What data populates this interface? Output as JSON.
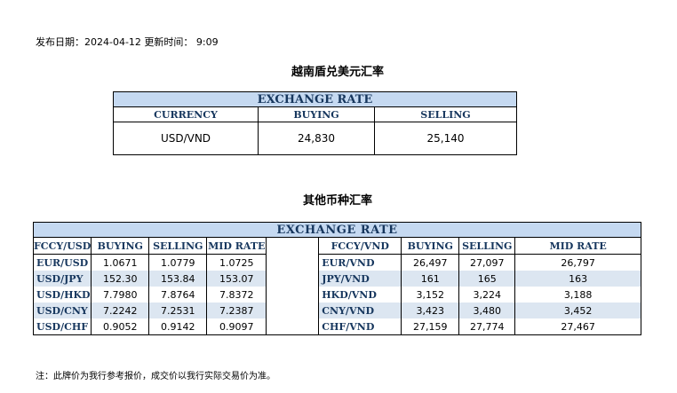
{
  "publish_line": "发布日期：2024-04-12 更新时间： 9:09",
  "section1": {
    "title": "越南盾兑美元汇率",
    "table_title": "EXCHANGE RATE",
    "headers": [
      "CURRENCY",
      "BUYING",
      "SELLING"
    ],
    "row": [
      "USD/VND",
      "24,830",
      "25,140"
    ]
  },
  "section2": {
    "title": "其他币种汇率",
    "table_title": "EXCHANGE  RATE",
    "left_headers": [
      "FCCY/USD",
      "BUYING",
      "SELLING",
      "MID RATE"
    ],
    "right_headers": [
      "FCCY/VND",
      "BUYING",
      "SELLING",
      "MID RATE"
    ],
    "rows": [
      {
        "l": [
          "EUR/USD",
          "1.0671",
          "1.0779",
          "1.0725"
        ],
        "r": [
          "EUR/VND",
          "26,497",
          "27,097",
          "26,797"
        ]
      },
      {
        "l": [
          "USD/JPY",
          "152.30",
          "153.84",
          "153.07"
        ],
        "r": [
          "JPY/VND",
          "161",
          "165",
          "163"
        ]
      },
      {
        "l": [
          "USD/HKD",
          "7.7980",
          "7.8764",
          "7.8372"
        ],
        "r": [
          "HKD/VND",
          "3,152",
          "3,224",
          "3,188"
        ]
      },
      {
        "l": [
          "USD/CNY",
          "7.2242",
          "7.2531",
          "7.2387"
        ],
        "r": [
          "CNY/VND",
          "3,423",
          "3,480",
          "3,452"
        ]
      },
      {
        "l": [
          "USD/CHF",
          "0.9052",
          "0.9142",
          "0.9097"
        ],
        "r": [
          "CHF/VND",
          "27,159",
          "27,774",
          "27,467"
        ]
      }
    ]
  },
  "note": "注：此牌价为我行参考报价，成交价以我行实际交易价为准。",
  "colors": {
    "header_bg": "#c5d9f1",
    "alt_row_bg": "#dce6f1",
    "header_text": "#17375e"
  }
}
